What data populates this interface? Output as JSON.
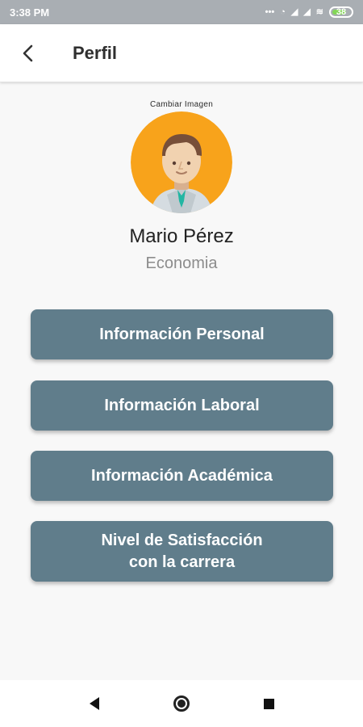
{
  "status_bar": {
    "time": "3:38 PM",
    "icons": [
      "more-icon",
      "alarm-icon",
      "signal-icon",
      "signal-icon",
      "wifi-icon",
      "battery-icon"
    ],
    "battery_level": "38"
  },
  "header": {
    "title": "Perfil",
    "back_icon": "chevron-left-icon"
  },
  "profile": {
    "change_image_label": "Cambiar Imagen",
    "name": "Mario Pérez",
    "field": "Economia",
    "avatar_icon": "avatar-icon"
  },
  "menu": {
    "personal": "Información Personal",
    "laboral": "Información Laboral",
    "academic": "Información Académica",
    "satisfaction_line1": "Nivel de Satisfacción",
    "satisfaction_line2": "con la carrera"
  },
  "navigation": {
    "icons": [
      "back-triangle-icon",
      "home-circle-icon",
      "recent-apps-icon"
    ]
  },
  "colors": {
    "accent": "#607d8b",
    "avatar_background": "#f8a31b",
    "status_bar": "#a9aeb3"
  }
}
